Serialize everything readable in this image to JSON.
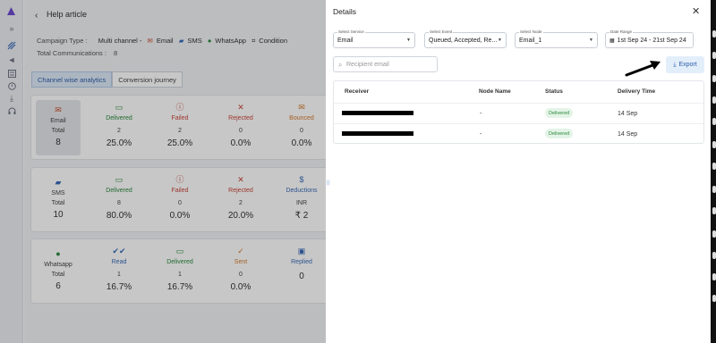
{
  "header": {
    "back_icon": "chevron-left-icon",
    "title": "Help article"
  },
  "campaign": {
    "type_label": "Campaign Type :",
    "type_value": "Multi channel -",
    "channels": [
      {
        "label": "Email",
        "icon": "email-icon"
      },
      {
        "label": "SMS",
        "icon": "sms-icon"
      },
      {
        "label": "WhatsApp",
        "icon": "whatsapp-icon"
      },
      {
        "label": "Condition",
        "icon": "condition-icon"
      }
    ],
    "total_label": "Total Communications :",
    "total_value": "8"
  },
  "tabs": [
    {
      "label": "Channel wise analytics",
      "active": true
    },
    {
      "label": "Conversion journey",
      "active": false
    }
  ],
  "analytics": {
    "email": {
      "name": "Email",
      "total_label": "Total",
      "total": "8",
      "metrics": [
        {
          "label": "Delivered",
          "count": "2",
          "pct": "25.0%",
          "color": "#2c8a3e"
        },
        {
          "label": "Failed",
          "count": "2",
          "pct": "25.0%",
          "color": "#c8473b"
        },
        {
          "label": "Rejected",
          "count": "0",
          "pct": "0.0%",
          "color": "#c8473b"
        },
        {
          "label": "Bounced",
          "count": "0",
          "pct": "0.0%",
          "color": "#d47a2e"
        }
      ]
    },
    "sms": {
      "name": "SMS",
      "total_label": "Total",
      "total": "10",
      "metrics": [
        {
          "label": "Delivered",
          "count": "8",
          "pct": "80.0%",
          "color": "#2c8a3e"
        },
        {
          "label": "Failed",
          "count": "0",
          "pct": "0.0%",
          "color": "#c8473b"
        },
        {
          "label": "Rejected",
          "count": "2",
          "pct": "20.0%",
          "color": "#c8473b"
        },
        {
          "label": "Deductions",
          "count": "INR",
          "pct": "₹ 2",
          "color": "#3b6cb8"
        }
      ]
    },
    "whatsapp": {
      "name": "Whatsapp",
      "total_label": "Total",
      "total": "6",
      "metrics": [
        {
          "label": "Read",
          "count": "1",
          "pct": "16.7%",
          "color": "#3b6cb8"
        },
        {
          "label": "Delivered",
          "count": "1",
          "pct": "16.7%",
          "color": "#2c8a3e"
        },
        {
          "label": "Sent",
          "count": "0",
          "pct": "0.0%",
          "color": "#d47a2e"
        },
        {
          "label": "Replied",
          "count": "",
          "pct": "0",
          "color": "#3b6cb8"
        }
      ]
    }
  },
  "details": {
    "title": "Details",
    "close_icon": "close-icon",
    "filters": {
      "service": {
        "legend": "Select Service",
        "value": "Email"
      },
      "event": {
        "legend": "Select Event",
        "value": "Queued, Accepted, Re..."
      },
      "node": {
        "legend": "Select Node",
        "value": "Email_1"
      },
      "date": {
        "legend": "Date Range",
        "value": "1st Sep 24 - 21st Sep 24"
      }
    },
    "search_placeholder": "Recipient email",
    "export_label": "Export",
    "table": {
      "headers": [
        "Receiver",
        "Node Name",
        "Status",
        "Delivery Time"
      ],
      "rows": [
        {
          "node": "-",
          "status": "Delivered",
          "time": "14 Sep"
        },
        {
          "node": "-",
          "status": "Delivered",
          "time": "14 Sep"
        }
      ]
    }
  },
  "colors": {
    "accent": "#2d5ea8",
    "delivered": "#2c8a3e",
    "failed": "#c8473b"
  }
}
